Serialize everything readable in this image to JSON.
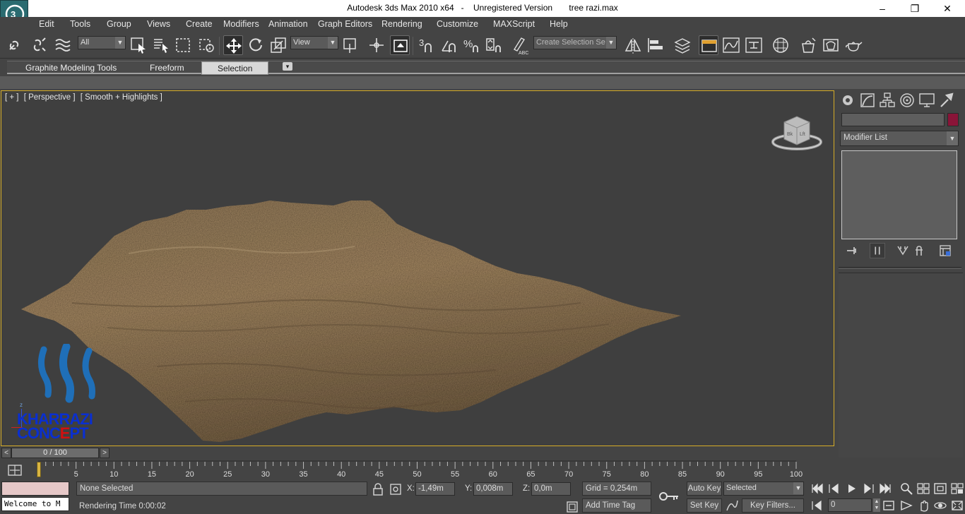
{
  "window": {
    "app_title": "Autodesk 3ds Max  2010 x64",
    "license": "Unregistered Version",
    "file_name": "tree razi.max",
    "minimize": "–",
    "maximize": "❐",
    "close": "✕"
  },
  "menu": [
    "Edit",
    "Tools",
    "Group",
    "Views",
    "Create",
    "Modifiers",
    "Animation",
    "Graph Editors",
    "Rendering",
    "Customize",
    "MAXScript",
    "Help"
  ],
  "toolbar": {
    "selection_filter": "All",
    "ref_coord": "View",
    "named_selection_placeholder": "Create Selection Se",
    "snap_3_label": "3"
  },
  "ribbon": {
    "tabs": [
      "Graphite Modeling Tools",
      "Freeform",
      "Selection"
    ],
    "active_tab": "Selection",
    "toggle": "▾"
  },
  "viewport": {
    "labels": [
      "[ + ]",
      "[ Perspective ]",
      "[ Smooth + Highlights ]"
    ],
    "viewcube": {
      "front": "Bk",
      "left": "Lft"
    },
    "watermark": {
      "line1": "KHARRAZI",
      "line2": "CONCEPT",
      "axis_label": "z",
      "colors": {
        "logo": "#1f6fb8",
        "text": "#0a2fd0",
        "accent_letter": "#d01010"
      }
    }
  },
  "command_panel": {
    "modifier_list": "Modifier List",
    "object_color": "#8a1438"
  },
  "time_slider": {
    "frame_display": "0 / 100",
    "prev": "<",
    "next": ">",
    "current_frame": 0,
    "total_frames": 100
  },
  "trackbar": {
    "ticks": [
      "5",
      "10",
      "15",
      "20",
      "25",
      "30",
      "35",
      "40",
      "45",
      "50",
      "55",
      "60",
      "65",
      "70",
      "75",
      "80",
      "85",
      "90",
      "95",
      "100"
    ]
  },
  "status": {
    "maxscript_listener": "Welcome to M",
    "selection_info": "None Selected",
    "prompt": "Rendering Time  0:00:02",
    "x_label": "X:",
    "x_value": "-1,49m",
    "y_label": "Y:",
    "y_value": "0,008m",
    "z_label": "Z:",
    "z_value": "0,0m",
    "grid": "Grid = 0,254m",
    "add_time_tag": "Add Time Tag",
    "auto_key": "Auto Key",
    "set_key": "Set Key",
    "key_mode": "Selected",
    "key_filters": "Key Filters...",
    "frame_field": "0"
  }
}
